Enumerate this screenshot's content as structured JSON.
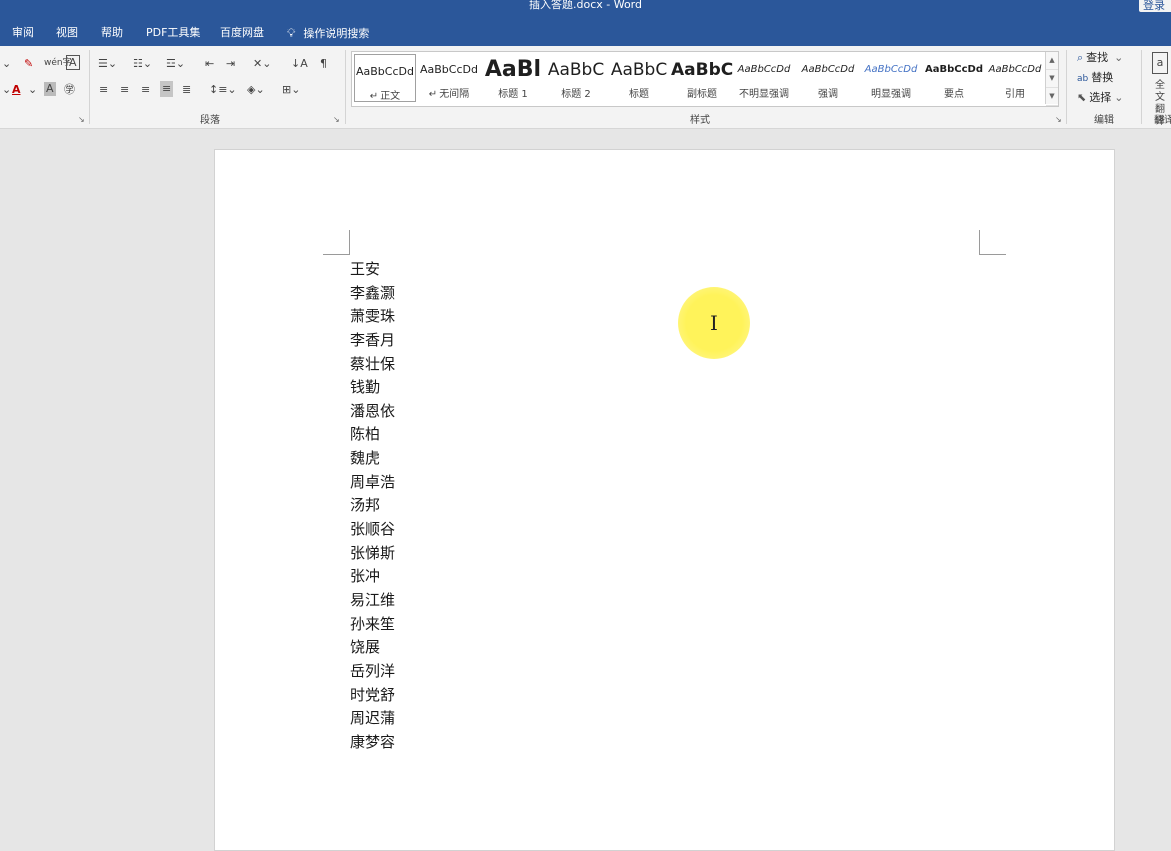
{
  "window": {
    "title": "插入答题.docx  -  Word",
    "signin_label": "登录"
  },
  "tabs": [
    {
      "label": "审阅"
    },
    {
      "label": "视图"
    },
    {
      "label": "帮助"
    },
    {
      "label": "PDF工具集"
    },
    {
      "label": "百度网盘"
    },
    {
      "label": "操作说明搜索",
      "icon": "lightbulb-icon"
    }
  ],
  "ribbon": {
    "paragraph_group_label": "段落",
    "styles_group_label": "样式",
    "editing_group_label": "编辑",
    "translate_group_label": "翻译",
    "styles": [
      {
        "sample": "AaBbCcDd",
        "name": "正文",
        "prefix": "↵",
        "size": "11"
      },
      {
        "sample": "AaBbCcDd",
        "name": "无间隔",
        "prefix": "↵",
        "size": "11"
      },
      {
        "sample": "AaBl",
        "name": "标题 1",
        "prefix": "",
        "size": "22",
        "bold": true
      },
      {
        "sample": "AaBbC",
        "name": "标题 2",
        "prefix": "",
        "size": "17"
      },
      {
        "sample": "AaBbC",
        "name": "标题",
        "prefix": "",
        "size": "17"
      },
      {
        "sample": "AaBbC",
        "name": "副标题",
        "prefix": "",
        "size": "17",
        "bold": true
      },
      {
        "sample": "AaBbCcDd",
        "name": "不明显强调",
        "prefix": "",
        "size": "10",
        "italic": true
      },
      {
        "sample": "AaBbCcDd",
        "name": "强调",
        "prefix": "",
        "size": "10",
        "italic": true
      },
      {
        "sample": "AaBbCcDd",
        "name": "明显强调",
        "prefix": "",
        "size": "10",
        "italic": true,
        "color": "#4472c4"
      },
      {
        "sample": "AaBbCcDd",
        "name": "要点",
        "prefix": "",
        "size": "10",
        "bold": true
      },
      {
        "sample": "AaBbCcDd",
        "name": "引用",
        "prefix": "",
        "size": "10",
        "italic": true
      }
    ],
    "editing": {
      "find_label": "查找",
      "replace_label": "替换",
      "select_label": "选择"
    },
    "translate": {
      "label_line1": "全文",
      "label_line2": "翻译"
    }
  },
  "document": {
    "names": [
      "王安",
      "李鑫灏",
      "萧雯珠",
      "李香月",
      "蔡壮保",
      "钱勤",
      "潘恩依",
      "陈柏",
      "魏虎",
      "周卓浩",
      "汤邦",
      "张顺谷",
      "张悌斯",
      "张冲",
      "易江维",
      "孙来笙",
      "饶展",
      "岳列洋",
      "时党舒",
      "周迟蒲",
      "康梦容"
    ]
  },
  "colors": {
    "title_bar": "#2b579a",
    "ribbon_bg": "#f3f3f3",
    "canvas_bg": "#e6e6e6",
    "cursor_highlight": "#fff35a"
  }
}
